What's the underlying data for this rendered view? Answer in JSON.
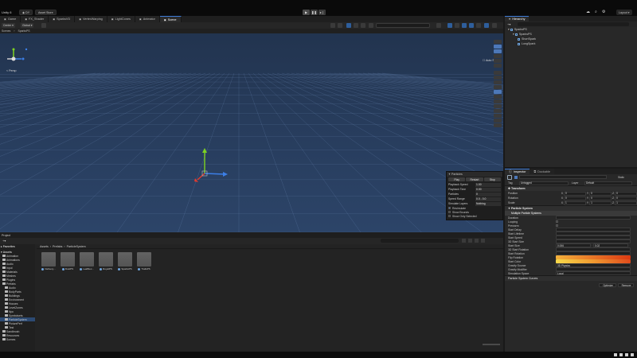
{
  "topbar": {
    "brand": "Unity 6",
    "account_label": "DY",
    "store_label": "Asset Store",
    "layout_label": "Layout"
  },
  "scene_tabs": [
    {
      "label": "Game",
      "active": false
    },
    {
      "label": "FX_Shader",
      "active": false
    },
    {
      "label": "SparksVD",
      "active": false
    },
    {
      "label": "VertexWarping",
      "active": false
    },
    {
      "label": "LightCones",
      "active": false
    },
    {
      "label": "Animator",
      "active": false
    },
    {
      "label": "Scene",
      "active": true
    }
  ],
  "scene_toolbar": {
    "center_label": "Center",
    "global_label": "Global",
    "persp_label": "Persp"
  },
  "breadcrumb": {
    "items": [
      "Scenes",
      "SparksPS"
    ]
  },
  "viewport": {
    "auto_save_label": "Auto Save",
    "persp_label": "< Persp"
  },
  "particle_overlay": {
    "title": "Particles",
    "buttons": [
      "Play",
      "Restart",
      "Stop"
    ],
    "rows": [
      {
        "key": "Playback Speed",
        "value": "1.00"
      },
      {
        "key": "Playback Time",
        "value": "0.00"
      },
      {
        "key": "Particles",
        "value": "0"
      },
      {
        "key": "Speed Range",
        "value": "0.0 - 0.0"
      },
      {
        "key": "Simulate Layers",
        "value": "Nothing"
      }
    ],
    "checks": [
      {
        "label": "Resimulate",
        "on": true
      },
      {
        "label": "Show Bounds",
        "on": false
      },
      {
        "label": "Show Only Selected",
        "on": false
      }
    ]
  },
  "hierarchy": {
    "tab_label": "Hierarchy",
    "items": [
      {
        "label": "SparksPS",
        "depth": 0,
        "selected": false
      },
      {
        "label": "SparksPS",
        "depth": 1,
        "selected": false
      },
      {
        "label": "ShortSpark",
        "depth": 2,
        "selected": false
      },
      {
        "label": "LongSpark",
        "depth": 2,
        "selected": false
      }
    ]
  },
  "inspector": {
    "tab_label": "Inspector",
    "tab2_label": "Dockable",
    "tag_label": "Tag",
    "tag_value": "Untagged",
    "layer_label": "Layer",
    "layer_value": "Default",
    "static_label": "Static",
    "transform_label": "Transform",
    "position_label": "Position",
    "rotation_label": "Rotation",
    "scale_label": "Scale",
    "pos": {
      "x": "0",
      "y": "0",
      "z": "0"
    },
    "rot": {
      "x": "0",
      "y": "0",
      "z": "0"
    },
    "scale": {
      "x": "1",
      "y": "1",
      "z": "1"
    },
    "particle_system_label": "Particle System",
    "multiple_label": "Multiple Particle Systems",
    "field_labels": [
      "Duration",
      "Looping",
      "Prewarm",
      "Start Delay",
      "Start Lifetime",
      "Start Speed",
      "3D Start Size",
      "Start Size",
      "3D Start Rotation",
      "Start Rotation",
      "Flip Rotation",
      "Start Color",
      "Gravity Source",
      "Gravity Modifier",
      "Simulation Space"
    ],
    "size_values": [
      "0.006",
      "0.02"
    ],
    "gravity_source_value": "3D Physics",
    "simulation_space_value": "Local",
    "curves_label": "Particle System Curves",
    "optimize_label": "Optimize",
    "remove_label": "Remove"
  },
  "project": {
    "tab_label": "Project",
    "favorites_label": "Favorites",
    "assets_label": "Assets",
    "tree": [
      "Animation",
      "Animations",
      "Audio",
      "Input",
      "Materials",
      "Meshes",
      "Plugins",
      "Prefabs",
      "Audio",
      "BodyParts",
      "Buildings",
      "Environment",
      "Houses",
      "LevelZones",
      "Npc",
      "Symbolsets",
      "ParticleSystem",
      "PicturePerf",
      "Test",
      "Sandbrush",
      "Resources",
      "Scenes"
    ],
    "path": [
      "Assets",
      "Prefabs",
      "ParticleSystem"
    ],
    "assets": [
      "Delivery...",
      "DustPS",
      "LeafDec...",
      "RoyalPS",
      "SparksPS",
      "TrailsPS"
    ]
  },
  "colors": {
    "accent": "#3d7bd6",
    "scene_top": "#22344f",
    "scene_bottom": "#2c4468"
  }
}
